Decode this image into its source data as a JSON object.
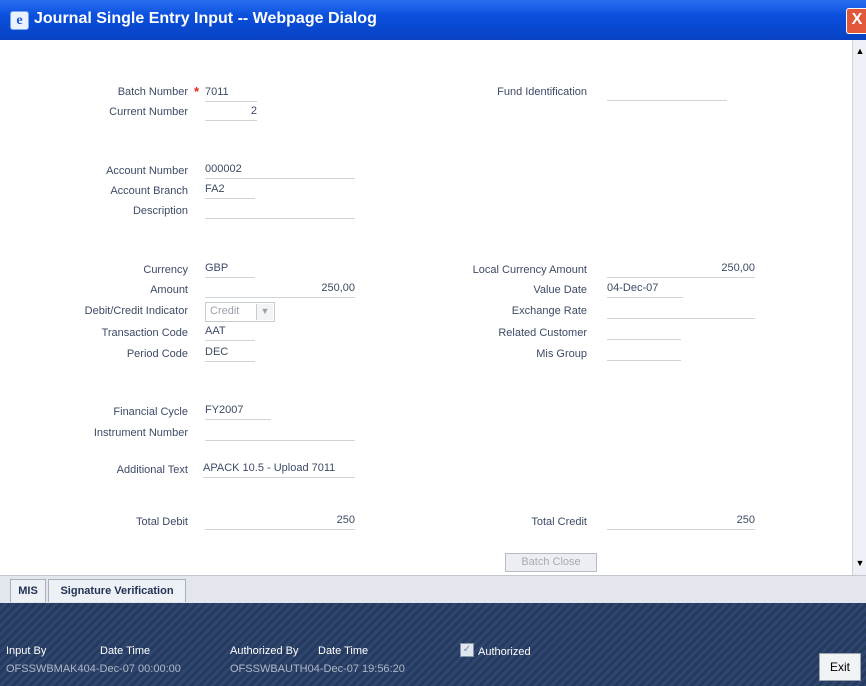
{
  "window": {
    "title": "Journal Single Entry Input -- Webpage Dialog",
    "close_symbol": "X"
  },
  "form": {
    "batch_number": {
      "label": "Batch Number",
      "value": "7011"
    },
    "current_number": {
      "label": "Current Number",
      "value": "2"
    },
    "fund_identification": {
      "label": "Fund Identification",
      "value": ""
    },
    "account_number": {
      "label": "Account Number",
      "value": "000002"
    },
    "account_branch": {
      "label": "Account Branch",
      "value": "FA2"
    },
    "description": {
      "label": "Description",
      "value": ""
    },
    "currency": {
      "label": "Currency",
      "value": "GBP"
    },
    "local_currency_amount": {
      "label": "Local Currency Amount",
      "value": "250,00"
    },
    "amount": {
      "label": "Amount",
      "value": "250,00"
    },
    "value_date": {
      "label": "Value Date",
      "value": "04-Dec-07"
    },
    "debit_credit_indicator": {
      "label": "Debit/Credit Indicator",
      "value": "Credit"
    },
    "exchange_rate": {
      "label": "Exchange Rate",
      "value": ""
    },
    "transaction_code": {
      "label": "Transaction Code",
      "value": "AAT"
    },
    "related_customer": {
      "label": "Related Customer",
      "value": ""
    },
    "period_code": {
      "label": "Period Code",
      "value": "DEC"
    },
    "mis_group": {
      "label": "Mis Group",
      "value": ""
    },
    "financial_cycle": {
      "label": "Financial Cycle",
      "value": "FY2007"
    },
    "instrument_number": {
      "label": "Instrument Number",
      "value": ""
    },
    "additional_text": {
      "label": "Additional Text",
      "value": "APACK 10.5 - Upload 7011"
    },
    "total_debit": {
      "label": "Total Debit",
      "value": "250"
    },
    "total_credit": {
      "label": "Total Credit",
      "value": "250"
    },
    "batch_close_label": "Batch Close"
  },
  "tabs": [
    {
      "label": "MIS"
    },
    {
      "label": "Signature Verification"
    }
  ],
  "footer": {
    "input_by_label": "Input By",
    "date_time_label": "Date Time",
    "authorized_by_label": "Authorized By",
    "auth_date_time_label": "Date Time",
    "authorized_label": "Authorized",
    "authorized_checked": true,
    "input_by_value": "OFSSWBMAK404-Dec-07 00:00:00",
    "authorized_by_value": "OFSSWBAUTH04-Dec-07 19:56:20",
    "exit_label": "Exit"
  }
}
